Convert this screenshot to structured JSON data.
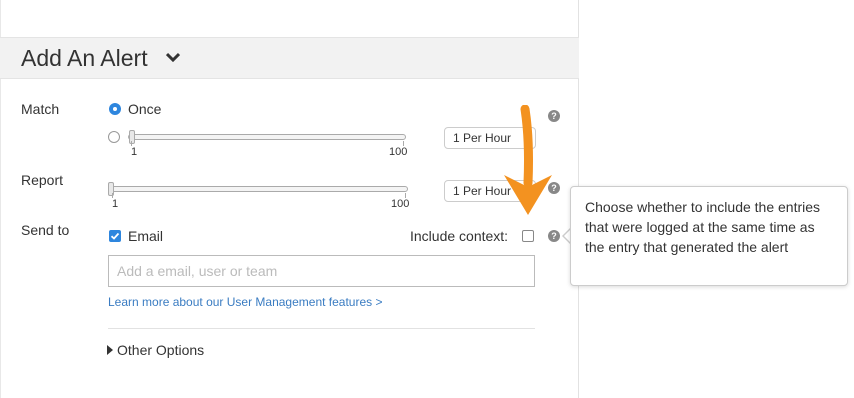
{
  "header": {
    "title": "Add An Alert"
  },
  "match": {
    "label": "Match",
    "option_once": "Once",
    "slider": {
      "min": "1",
      "max": "100"
    },
    "frequency": "1 Per Hour"
  },
  "report": {
    "label": "Report",
    "slider": {
      "min": "1",
      "max": "100"
    },
    "frequency": "1 Per Hour"
  },
  "send_to": {
    "label": "Send to",
    "email_label": "Email",
    "include_context_label": "Include context:",
    "input_placeholder": "Add a email, user or team",
    "learn_more": "Learn more about our User Management features >"
  },
  "other_options": "Other Options",
  "help_glyph": "?",
  "tooltip": "Choose whether to include the entries that were logged at the same time as the entry that generated the alert",
  "colors": {
    "accent": "#2e86de",
    "arrow": "#f39220",
    "link": "#3a7cc2"
  }
}
